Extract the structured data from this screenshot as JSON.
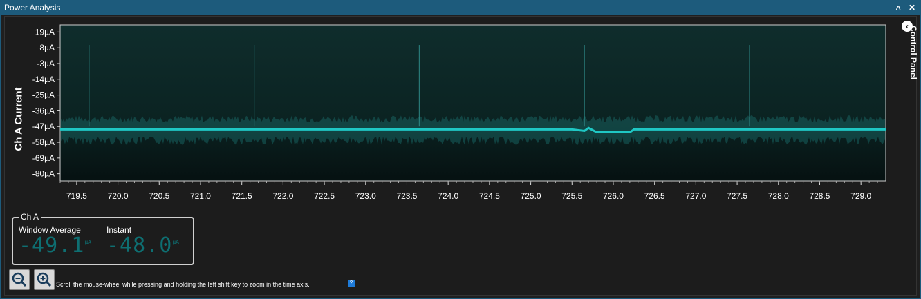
{
  "window": {
    "title": "Power Analysis",
    "collapse_icon": "chevron-up-icon",
    "close_icon": "close-icon"
  },
  "control_panel": {
    "label": "Control Panel",
    "icon": "chevron-left-icon"
  },
  "chart_data": {
    "type": "line",
    "ylabel": "Ch A Current",
    "y_ticks": [
      "19µA",
      "8µA",
      "-3µA",
      "-14µA",
      "-25µA",
      "-36µA",
      "-47µA",
      "-58µA",
      "-69µA",
      "-80µA"
    ],
    "x_ticks": [
      "719.5",
      "720.0",
      "720.5",
      "721.0",
      "721.5",
      "722.0",
      "722.5",
      "723.0",
      "723.5",
      "724.0",
      "724.5",
      "725.0",
      "725.5",
      "726.0",
      "726.5",
      "727.0",
      "727.5",
      "728.0",
      "728.5",
      "729.0"
    ],
    "xlim": [
      719.3,
      729.3
    ],
    "ylim": [
      -85,
      24
    ],
    "series": [
      {
        "values_x": [
          719.3,
          725.5,
          725.65,
          725.7,
          725.8,
          726.2,
          726.25,
          729.3
        ],
        "values_y": [
          -49,
          -49,
          -50,
          -48,
          -51,
          -51,
          -49,
          -49
        ]
      }
    ],
    "spikes_x": [
      719.65,
      721.65,
      723.65,
      725.65,
      727.65
    ],
    "spike_top_y": 10,
    "colors": {
      "trace": "#1fc7c4",
      "plot_bg_top": "#0f2d2c",
      "plot_bg_bottom": "#061111"
    }
  },
  "channel_panel": {
    "title": "Ch A",
    "window_average_label": "Window Average",
    "instant_label": "Instant",
    "window_average_value": "-49.1",
    "instant_value": "-48.0",
    "unit": "µA"
  },
  "toolbar": {
    "zoom_out_icon": "zoom-out-icon",
    "zoom_in_icon": "zoom-in-icon",
    "hint": "Scroll the mouse-wheel while pressing and holding the left shift key to zoom in the time axis.",
    "help_label": "?"
  }
}
